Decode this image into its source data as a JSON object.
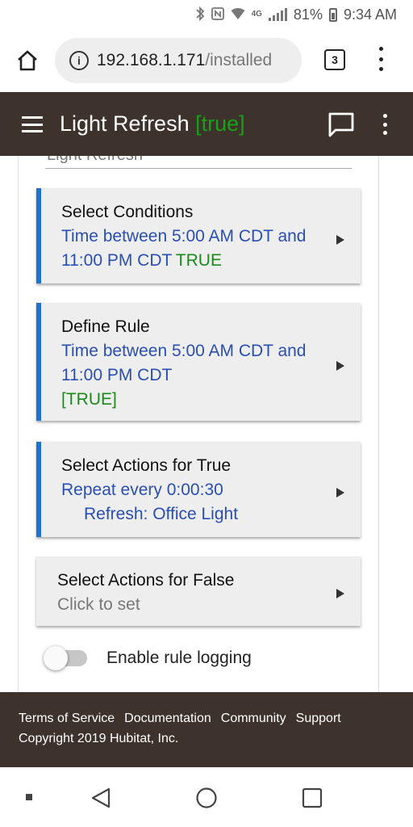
{
  "status_bar": {
    "battery": "81%",
    "time": "9:34 AM",
    "network": "4G",
    "icons": [
      "bluetooth-icon",
      "nfc-icon",
      "wifi-icon",
      "signal-icon",
      "battery-icon"
    ]
  },
  "browser": {
    "url_host": "192.168.1.171",
    "url_path": "/installed",
    "tab_count": "3",
    "icons": [
      "home-icon",
      "info-icon",
      "tabs-icon",
      "more-vert-icon"
    ]
  },
  "app_header": {
    "title": "Light Refresh",
    "state": "[true]",
    "state_color": "#18a018",
    "background": "#3e322d",
    "icons": [
      "menu-icon",
      "chat-icon",
      "more-vert-icon"
    ]
  },
  "content": {
    "partial_section_label": "Light Refresh",
    "accent_color": "#1e73d2",
    "link_color": "#2a4fb3",
    "cards": [
      {
        "title": "Select Conditions",
        "line1": "Time between 5:00 AM CDT and",
        "line2": "11:00 PM CDT",
        "state": "TRUE"
      },
      {
        "title": "Define Rule",
        "line1": "Time between 5:00 AM CDT and",
        "line2": "11:00 PM CDT",
        "state": "[TRUE]"
      },
      {
        "title": "Select Actions for True",
        "line1": "Repeat every 0:00:30",
        "line2": "Refresh: Office Light"
      },
      {
        "title": "Select Actions for False",
        "hint": "Click to set"
      }
    ],
    "toggle": {
      "label": "Enable rule logging",
      "on": false
    }
  },
  "footer": {
    "links": [
      "Terms of Service",
      "Documentation",
      "Community",
      "Support"
    ],
    "copyright": "Copyright 2019 Hubitat, Inc."
  },
  "nav_bar": {
    "icons": [
      "recents-dot-icon",
      "back-icon",
      "home-circle-icon",
      "overview-square-icon"
    ]
  }
}
